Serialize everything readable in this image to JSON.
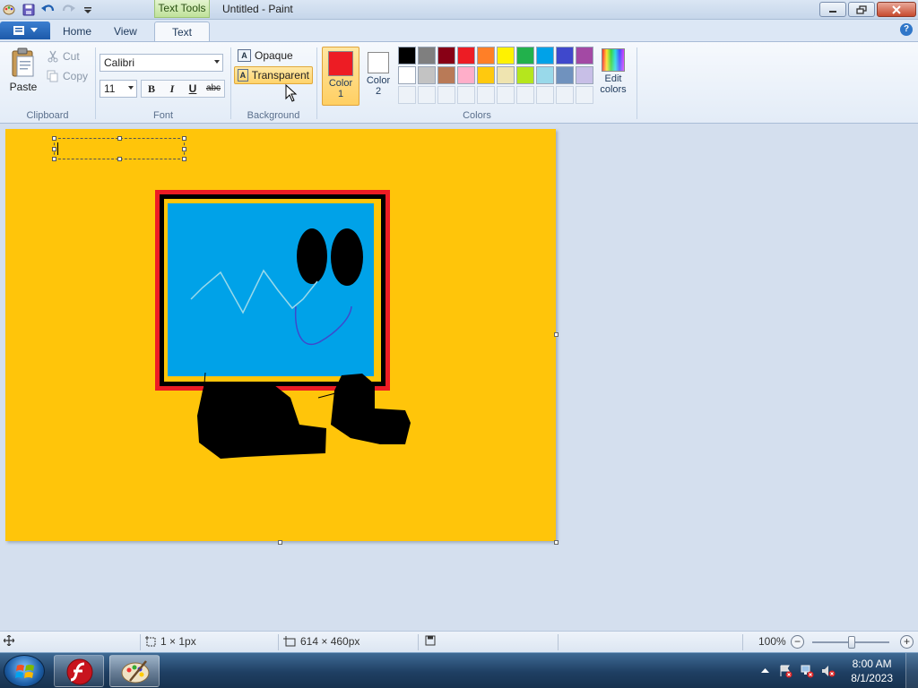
{
  "window": {
    "title": "Untitled - Paint",
    "context_tab": "Text Tools"
  },
  "tabs": [
    {
      "label": "Home"
    },
    {
      "label": "View"
    },
    {
      "label": "Text",
      "active": true
    }
  ],
  "ribbon": {
    "clipboard": {
      "label": "Clipboard",
      "paste": "Paste",
      "cut": "Cut",
      "copy": "Copy"
    },
    "font": {
      "label": "Font",
      "family": "Calibri",
      "size": "11",
      "bold": "B",
      "italic": "I",
      "underline": "U",
      "strike": "abc"
    },
    "background": {
      "label": "Background",
      "opaque": "Opaque",
      "transparent": "Transparent",
      "selected": "Transparent"
    },
    "colors": {
      "label": "Colors",
      "color1": {
        "label": "Color 1",
        "value": "#ed1c24"
      },
      "color2": {
        "label": "Color 2",
        "value": "#ffffff"
      },
      "edit": "Edit colors",
      "palette_row1": [
        "#000000",
        "#7f7f7f",
        "#880015",
        "#ed1c24",
        "#ff7f27",
        "#fff200",
        "#22b14c",
        "#00a2e8",
        "#3f48cc",
        "#a349a4"
      ],
      "palette_row2": [
        "#ffffff",
        "#c3c3c3",
        "#b97a57",
        "#ffaec9",
        "#ffc90e",
        "#efe4b0",
        "#b5e61d",
        "#99d9ea",
        "#7092be",
        "#c8bfe7"
      ]
    }
  },
  "canvas": {
    "background": "#ffc50a",
    "drawing": {
      "frame_outer": "#ed1c24",
      "frame_inner": "#000000",
      "screen": "#00a2e8",
      "eyes": "#000000",
      "feet": "#000000",
      "scribble": "#99d9ea"
    }
  },
  "status": {
    "selection_size": "1 × 1px",
    "image_size": "614 × 460px",
    "zoom": "100%"
  },
  "taskbar": {
    "time": "8:00 AM",
    "date": "8/1/2023"
  }
}
